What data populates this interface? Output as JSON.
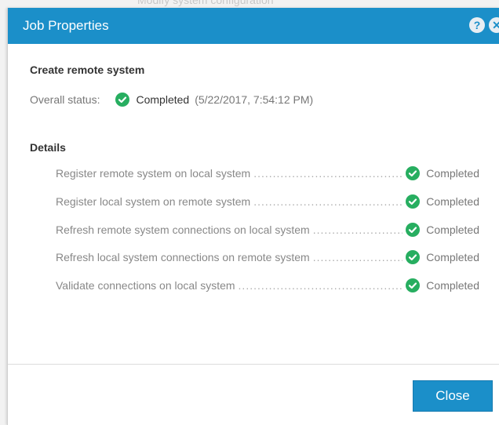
{
  "background": {
    "text": "Modify system configuration"
  },
  "dialog": {
    "title": "Job Properties",
    "icons": {
      "help": "question-icon",
      "close": "close-icon"
    },
    "heading": "Create remote system",
    "overall": {
      "label": "Overall status:",
      "status": "Completed",
      "timestamp": "(5/22/2017, 7:54:12 PM)"
    },
    "details_heading": "Details",
    "details": [
      {
        "label": "Register remote system on local system",
        "status": "Completed"
      },
      {
        "label": "Register local system on remote system",
        "status": "Completed"
      },
      {
        "label": "Refresh remote system connections on local system",
        "status": "Completed"
      },
      {
        "label": "Refresh local system connections on remote system",
        "status": "Completed"
      },
      {
        "label": "Validate connections on local system",
        "status": "Completed"
      }
    ],
    "close_label": "Close"
  },
  "colors": {
    "accent": "#1b8fc9",
    "success": "#27ae60"
  }
}
